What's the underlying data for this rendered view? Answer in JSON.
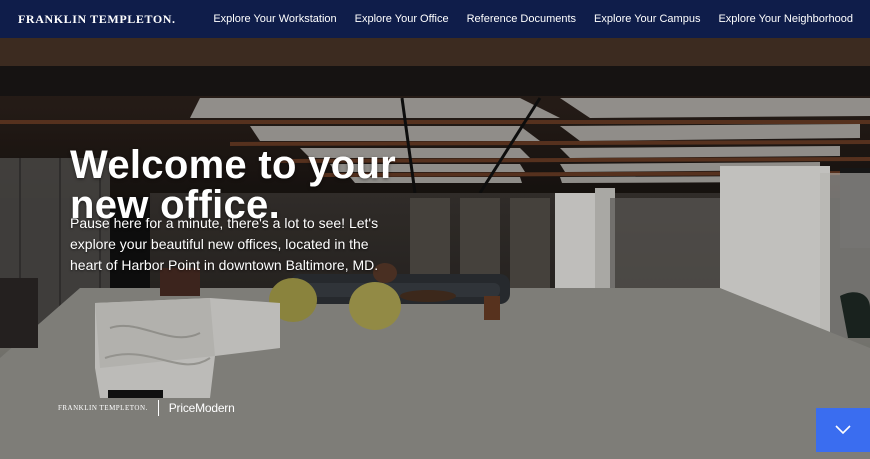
{
  "header": {
    "brand": "FRANKLIN TEMPLETON.",
    "nav": [
      {
        "label": "Explore Your Workstation"
      },
      {
        "label": "Explore Your Office"
      },
      {
        "label": "Reference Documents"
      },
      {
        "label": "Explore Your Campus"
      },
      {
        "label": "Explore Your Neighborhood"
      }
    ]
  },
  "hero": {
    "title_line1": "Welcome to your",
    "title_line2": "new office.",
    "intro": "Pause here for a minute, there's a lot to see! Let's explore your beautiful new offices, located in the heart of Harbor Point in downtown Baltimore, MD.",
    "logo_franklin": "FRANKLIN TEMPLETON.",
    "logo_pricemodern": "PriceModern",
    "scroll_icon": "chevron-down-icon"
  },
  "colors": {
    "nav_bg": "#0f1d4a",
    "accent": "#3a6df0"
  }
}
